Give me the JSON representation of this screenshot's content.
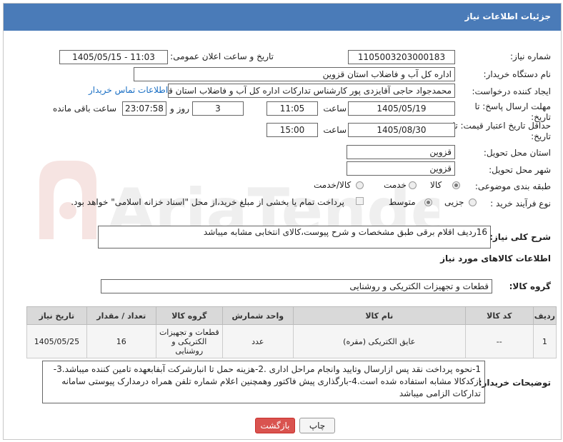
{
  "header": {
    "title": "جزئیات اطلاعات نیاز"
  },
  "fields": {
    "need_number_label": "شماره نیاز:",
    "need_number": "1105003203000183",
    "announce_label": "تاریخ و ساعت اعلان عمومی:",
    "announce_value": "1405/05/15 - 11:03",
    "buyer_org_label": "نام دستگاه خریدار:",
    "buyer_org": "اداره کل آب و فاضلاب استان قزوین",
    "creator_label": "ایجاد کننده درخواست:",
    "creator": "محمدجواد حاجی آقایزدی پور کارشناس تدارکات اداره کل آب و فاضلاب استان قزوین",
    "contact_link": "اطلاعات تماس خریدار",
    "deadline_label": "مهلت ارسال پاسخ: تا تاریخ:",
    "deadline_date": "1405/05/19",
    "time_label": "ساعت",
    "deadline_time": "11:05",
    "days_value": "3",
    "days_label": "روز و",
    "remaining_time": "23:07:58",
    "remaining_label": "ساعت باقی مانده",
    "validity_label": "حداقل تاریخ اعتبار قیمت: تا تاریخ:",
    "validity_date": "1405/08/30",
    "validity_time": "15:00",
    "province_label": "استان محل تحویل:",
    "province": "قزوین",
    "city_label": "شهر محل تحویل:",
    "city": "قزوین",
    "category_label": "طبقه بندی موضوعی:",
    "category_options": [
      "کالا",
      "خدمت",
      "کالا/خدمت"
    ],
    "process_label": "نوع فرآیند خرید :",
    "process_options": [
      "جزیی",
      "متوسط"
    ],
    "payment_note": "پرداخت تمام یا بخشی از مبلغ خرید،از محل \"اسناد خزانه اسلامی\" خواهد بود."
  },
  "description": {
    "label": "شرح کلی نیاز:",
    "text": "16ردیف اقلام برقی طبق مشخصات و شرح پیوست،کالای انتخابی مشابه میباشد"
  },
  "goods": {
    "section_title": "اطلاعات کالاهای مورد نیاز",
    "group_label": "گروه کالا:",
    "group_value": "قطعات و تجهیزات الکتریکی و روشنایی",
    "columns": [
      "ردیف",
      "کد کالا",
      "نام کالا",
      "واحد شمارش",
      "گروه کالا",
      "تعداد / مقدار",
      "تاریخ نیاز"
    ],
    "rows": [
      {
        "row": "1",
        "code": "--",
        "name": "عایق الکتریکی (مقره)",
        "unit": "عدد",
        "group": "قطعات و تجهیزات الکتریکی و روشنایی",
        "qty": "16",
        "date": "1405/05/25"
      }
    ]
  },
  "notes": {
    "label": "توضیحات خریدار:",
    "text": "1-نحوه پرداخت نقد پس ازارسال وتایید وانجام مراحل اداری .2-هزینه حمل تا انبارشرکت آبفابعهده تامین کننده میباشد.3-ازکدکالا مشابه استفاده شده است.4-بارگذاری پیش فاکتور وهمچنین اعلام شماره تلفن همراه درمدارک پیوستی سامانه تدارکات الزامی میباشد"
  },
  "buttons": {
    "print": "چاپ",
    "back": "بازگشت"
  },
  "watermark": {
    "text": "AriaTender.neT"
  },
  "colors": {
    "header": "#4a7bb8",
    "link": "#1a6fc4",
    "back_button": "#d9534f"
  }
}
